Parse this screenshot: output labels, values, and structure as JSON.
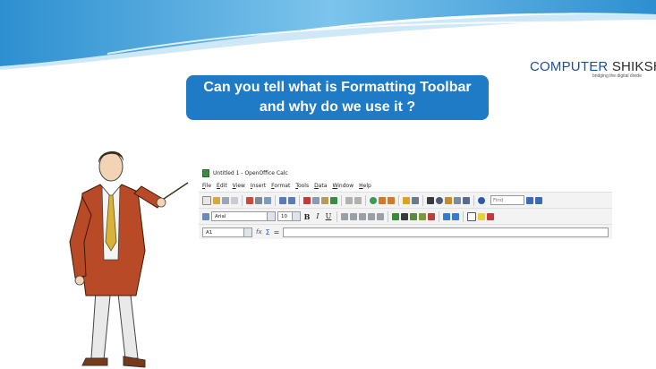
{
  "slide": {
    "question": "Can you tell what is Formatting Toolbar and why do we use it ?",
    "question_line1": "Can you tell what is Formatting Toolbar",
    "question_line2": "and why do we use it ?"
  },
  "logo": {
    "brand": "COMPUTER",
    "brand2": "SHIKSHA",
    "tagline": "bridging the digital divide"
  },
  "app": {
    "window_title": "Untitled 1 - OpenOffice Calc",
    "menu": [
      "File",
      "Edit",
      "View",
      "Insert",
      "Format",
      "Tools",
      "Data",
      "Window",
      "Help"
    ],
    "find_placeholder": "Find",
    "font_name": "Arial",
    "font_size": "10",
    "bold": "B",
    "italic": "I",
    "underline": "U",
    "cell_ref": "A1",
    "function_label": "fx",
    "sum_label": "Σ",
    "equals_label": "="
  }
}
